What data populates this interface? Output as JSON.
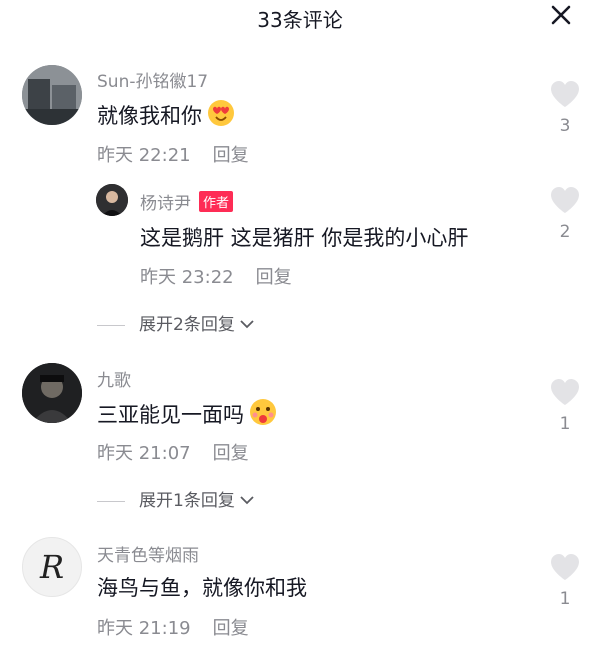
{
  "header": {
    "title": "33条评论",
    "close_icon": "close-icon"
  },
  "comments": [
    {
      "username": "Sun-孙铭徽17",
      "text": "就像我和你",
      "emoji": "smiling-face-with-heart-eyes",
      "time": "昨天 22:21",
      "reply": "回复",
      "likes": "3",
      "replies": [
        {
          "username": "杨诗尹",
          "badge": "作者",
          "text": "这是鹅肝 这是猪肝 你是我的小心肝",
          "time": "昨天 23:22",
          "reply": "回复",
          "likes": "2"
        }
      ],
      "expand": "展开2条回复"
    },
    {
      "username": "九歌",
      "text": "三亚能见一面吗",
      "emoji": "face-blowing-kiss",
      "time": "昨天 21:07",
      "reply": "回复",
      "likes": "1",
      "expand": "展开1条回复"
    },
    {
      "username": "天青色等烟雨",
      "avatar_letter": "R",
      "text": "海鸟与鱼，就像你和我",
      "time": "昨天 21:19",
      "reply": "回复",
      "likes": "1"
    }
  ]
}
